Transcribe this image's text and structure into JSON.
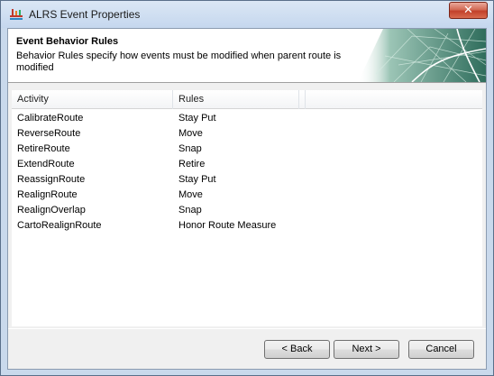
{
  "window": {
    "title": "ALRS Event Properties",
    "close_glyph": "✕"
  },
  "header": {
    "title": "Event Behavior Rules",
    "description": "Behavior Rules specify how events must be modified when parent route is modified"
  },
  "table": {
    "columns": [
      "Activity",
      "Rules"
    ],
    "rows": [
      {
        "activity": "CalibrateRoute",
        "rule": "Stay Put"
      },
      {
        "activity": "ReverseRoute",
        "rule": "Move"
      },
      {
        "activity": "RetireRoute",
        "rule": "Snap"
      },
      {
        "activity": "ExtendRoute",
        "rule": "Retire"
      },
      {
        "activity": "ReassignRoute",
        "rule": "Stay Put"
      },
      {
        "activity": "RealignRoute",
        "rule": "Move"
      },
      {
        "activity": "RealignOverlap",
        "rule": "Snap"
      },
      {
        "activity": "CartoRealignRoute",
        "rule": "Honor Route Measure"
      }
    ]
  },
  "buttons": {
    "back": "< Back",
    "next": "Next >",
    "cancel": "Cancel"
  },
  "colors": {
    "close_button": "#c2402a",
    "title_bar": "#c9d9ec",
    "banner": "#3f7a6a"
  },
  "icons": {
    "app": "alrs-app-icon",
    "close": "close-icon",
    "banner": "map-banner-image"
  }
}
